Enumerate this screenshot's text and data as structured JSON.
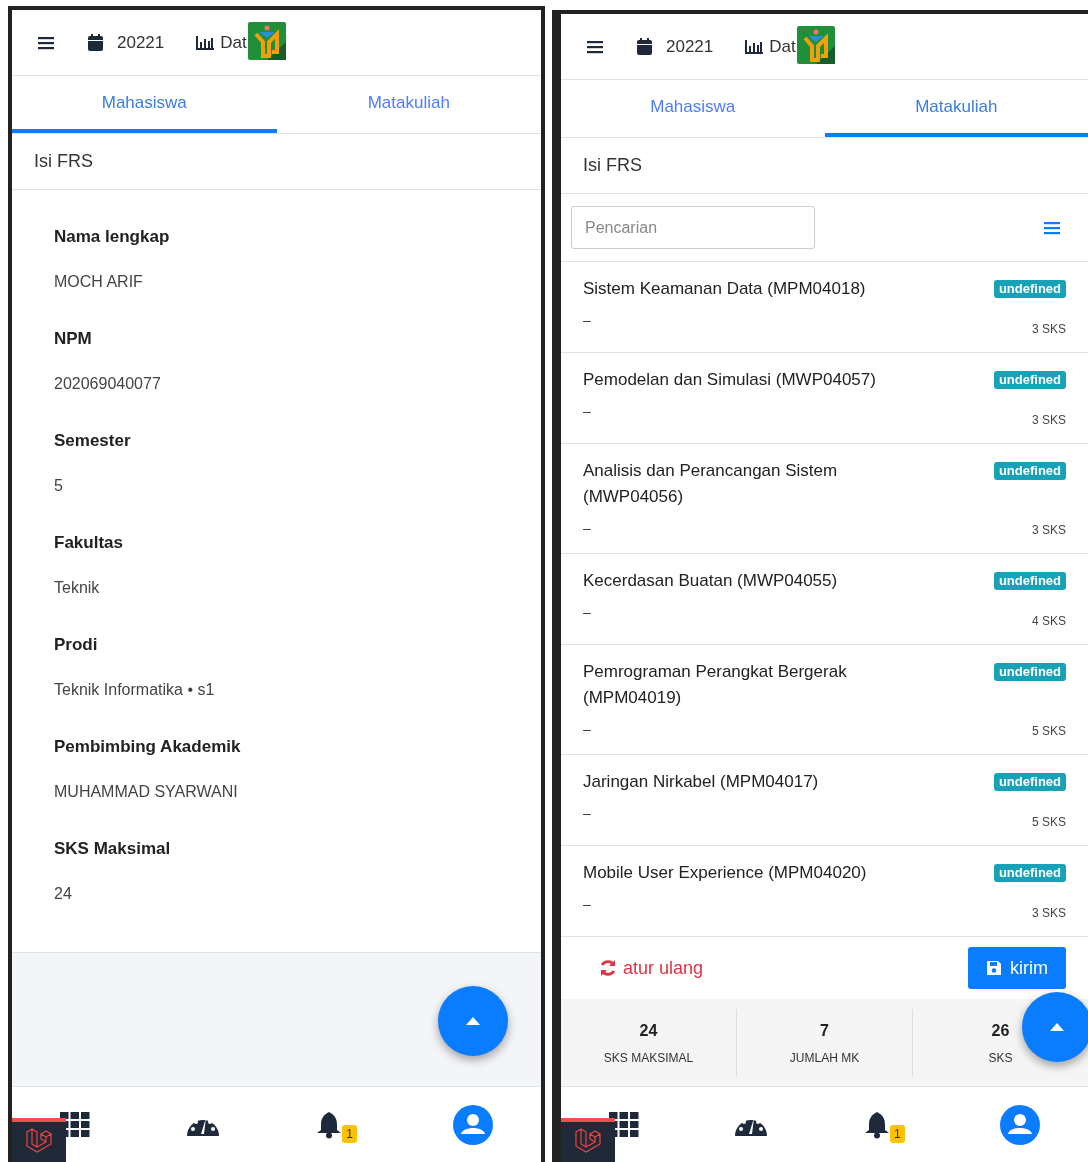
{
  "screens": [
    {
      "kind": "profile",
      "header": {
        "semester": "20221",
        "data_label": "Dat"
      },
      "tabs": [
        {
          "label": "Mahasiswa",
          "selected": true
        },
        {
          "label": "Matakuliah",
          "selected": false
        }
      ],
      "section_title": "Isi FRS",
      "fields": [
        {
          "label": "Nama lengkap",
          "value": "MOCH ARIF"
        },
        {
          "label": "NPM",
          "value": "202069040077"
        },
        {
          "label": "Semester",
          "value": "5"
        },
        {
          "label": "Fakultas",
          "value": "Teknik"
        },
        {
          "label": "Prodi",
          "value": "Teknik Informatika • s1"
        },
        {
          "label": "Pembimbing Akademik",
          "value": "MUHAMMAD SYARWANI"
        },
        {
          "label": "SKS Maksimal",
          "value": "24"
        }
      ],
      "notification_count": "1"
    },
    {
      "kind": "courses",
      "header": {
        "semester": "20221",
        "data_label": "Dat"
      },
      "tabs": [
        {
          "label": "Mahasiswa",
          "selected": false
        },
        {
          "label": "Matakuliah",
          "selected": true
        }
      ],
      "section_title": "Isi FRS",
      "search": {
        "placeholder": "Pencarian"
      },
      "courses": [
        {
          "title": "Sistem Keamanan Data (MPM04018)",
          "note": "–",
          "badge": "undefined",
          "sks": "3 SKS"
        },
        {
          "title": "Pemodelan dan Simulasi (MWP04057)",
          "note": "–",
          "badge": "undefined",
          "sks": "3 SKS"
        },
        {
          "title": "Analisis dan Perancangan Sistem (MWP04056)",
          "note": "–",
          "badge": "undefined",
          "sks": "3 SKS"
        },
        {
          "title": "Kecerdasan Buatan (MWP04055)",
          "note": "–",
          "badge": "undefined",
          "sks": "4 SKS"
        },
        {
          "title": "Pemrograman Perangkat Bergerak (MPM04019)",
          "note": "–",
          "badge": "undefined",
          "sks": "5 SKS"
        },
        {
          "title": "Jaringan Nirkabel (MPM04017)",
          "note": "–",
          "badge": "undefined",
          "sks": "5 SKS"
        },
        {
          "title": "Mobile User Experience (MPM04020)",
          "note": "–",
          "badge": "undefined",
          "sks": "3 SKS"
        }
      ],
      "reset_label": "atur ulang",
      "submit_label": "kirim",
      "summary": [
        {
          "value": "24",
          "label": "SKS MAKSIMAL"
        },
        {
          "value": "7",
          "label": "JUMLAH MK"
        },
        {
          "value": "26",
          "label": "SKS"
        }
      ],
      "notification_count": "1"
    }
  ]
}
